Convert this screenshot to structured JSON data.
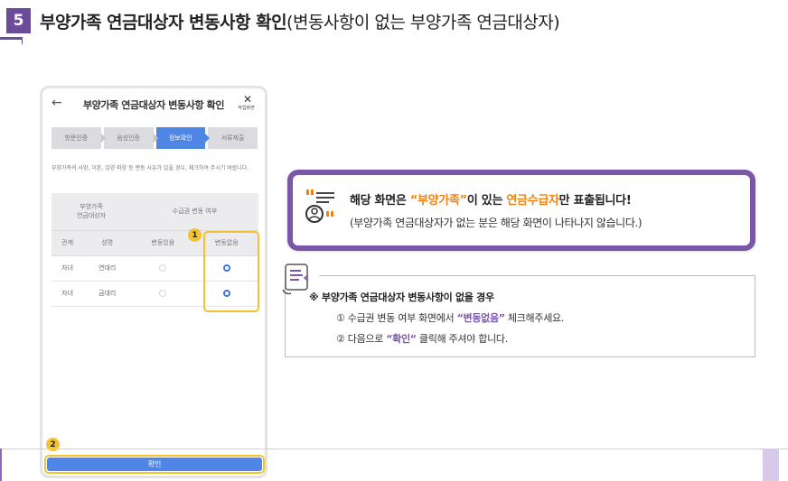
{
  "header": {
    "step_number": "5",
    "title_strong": "부양가족 연금대상자 변동사항 확인",
    "title_sub": "(변동사항이 없는 부양가족 연금대상자)"
  },
  "phone": {
    "back_icon": "arrow-left-icon",
    "title": "부양가족 연금대상자 변동사항 확인",
    "close_label": "작업화면",
    "steps": [
      "방문인증",
      "음성인증",
      "정보확인",
      "서류제출"
    ],
    "active_step": 2,
    "description": "부양가족의 사망, 이혼, 입양·파양 등 변동 사유가 있을 경우, 체크하여 주시기 바랍니다.",
    "table": {
      "header_group_left": "부양가족\n연금대상자",
      "header_group_right": "수급권 변동 여부",
      "columns": [
        "관계",
        "성명",
        "변동있음",
        "변동없음"
      ],
      "rows": [
        {
          "relation": "자녀",
          "name": "연대리",
          "changed": false,
          "unchanged": true
        },
        {
          "relation": "자녀",
          "name": "금대리",
          "changed": false,
          "unchanged": true
        }
      ]
    },
    "confirm_label": "확인",
    "marker1": "1",
    "marker2": "2"
  },
  "callout": {
    "icon": "quote-person-icon",
    "line1_pre": "해당 화면은 ",
    "line1_hl1": "“부양가족”",
    "line1_mid": "이 있는 ",
    "line1_hl2": "연금수급자",
    "line1_post": "만 표출됩니다!",
    "line2": "(부양가족 연금대상자가 없는 분은 해당 화면이 나타나지 않습니다.)"
  },
  "notice": {
    "icon": "document-note-icon",
    "title": "※ 부양가족 연금대상자 변동사항이 없을 경우",
    "item1_pre": "① 수급권 변동 여부 화면에서 ",
    "item1_hl": "“변동없음”",
    "item1_post": " 체크해주세요.",
    "item2_pre": "② 다음으로 ",
    "item2_hl": "“확인“",
    "item2_post": " 클릭해 주셔야 합니다."
  },
  "colors": {
    "accent_purple": "#7b57a8",
    "highlight_orange": "#f0820f",
    "button_blue": "#4f86e6",
    "marker_yellow": "#f2c230"
  }
}
